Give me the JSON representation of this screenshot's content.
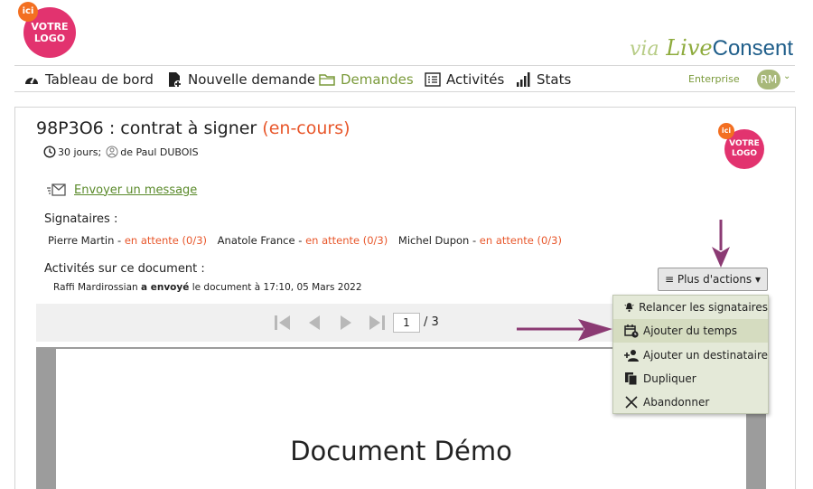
{
  "logo": {
    "ici": "ici",
    "line1": "VOTRE",
    "line2": "LOGO"
  },
  "brand": {
    "via": "via",
    "live": "Live",
    "consent": "Consent"
  },
  "nav": {
    "items": [
      {
        "label": "Tableau de bord",
        "icon": "dashboard-icon"
      },
      {
        "label": "Nouvelle demande",
        "icon": "new-document-icon"
      },
      {
        "label": "Demandes",
        "icon": "folder-icon"
      },
      {
        "label": "Activités",
        "icon": "list-icon"
      },
      {
        "label": "Stats",
        "icon": "stats-icon"
      }
    ],
    "enterprise": "Enterprise",
    "avatar": "RM",
    "avatar_chevron": "⌄"
  },
  "request": {
    "code": "98P3O6",
    "separator": " : ",
    "name": "contrat à signer",
    "status": "(en-cours)",
    "duration": "30 jours;",
    "author": "de Paul DUBOIS"
  },
  "send_message": "Envoyer un message",
  "signers": {
    "label": "Signataires :",
    "items": [
      {
        "name": "Pierre Martin",
        "status": "en attente (0/3)"
      },
      {
        "name": "Anatole France",
        "status": "en attente (0/3)"
      },
      {
        "name": "Michel Dupon",
        "status": "en attente (0/3)"
      }
    ]
  },
  "activities": {
    "label": "Activités sur ce document :",
    "entry": {
      "user": "Raffi Mardirossian",
      "action": "a envoyé",
      "rest": "le document à 17:10, 05 Mars 2022"
    }
  },
  "viewer": {
    "page": "1",
    "total": "/ 3",
    "doc_title": "Document Démo"
  },
  "actions": {
    "button": "≡ Plus d'actions ▾",
    "menu": [
      {
        "label": "Relancer les signataires",
        "icon": "bell-icon"
      },
      {
        "label": "Ajouter du temps",
        "icon": "calendar-clock-icon"
      },
      {
        "label": "Ajouter un destinataire",
        "icon": "add-user-icon"
      },
      {
        "label": "Dupliquer",
        "icon": "copy-icon"
      },
      {
        "label": "Abandonner",
        "icon": "close-icon"
      }
    ]
  },
  "colors": {
    "accent_green": "#7a9a3a",
    "status_orange": "#e8572b",
    "arrow_purple": "#8b3a73",
    "logo_pink": "#e2336f"
  }
}
